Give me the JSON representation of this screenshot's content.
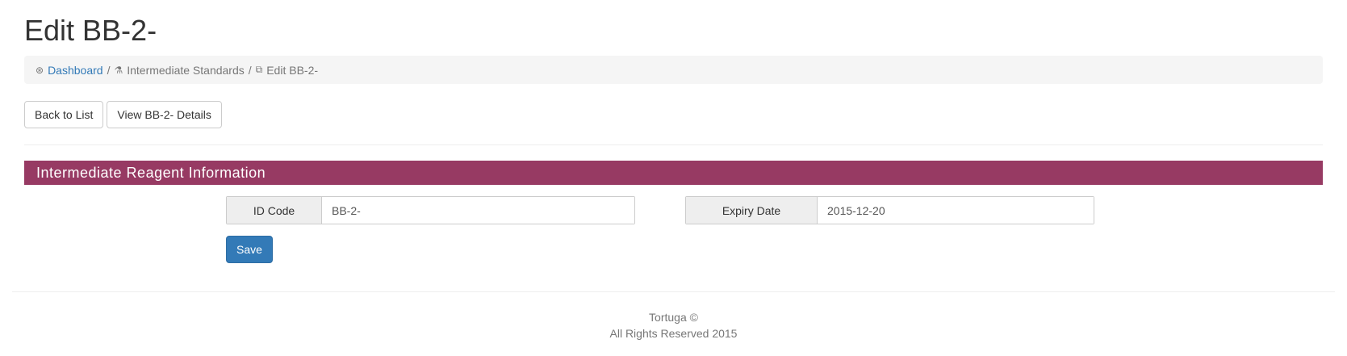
{
  "page": {
    "title": "Edit BB-2-"
  },
  "breadcrumb": {
    "items": [
      {
        "icon": "dashboard-icon",
        "glyph": "⊛",
        "label": "Dashboard"
      },
      {
        "icon": "flask-icon",
        "glyph": "⚗",
        "label": "Intermediate Standards"
      },
      {
        "icon": "copy-icon",
        "glyph": "⧉",
        "label": "Edit BB-2-"
      }
    ],
    "separator": "/"
  },
  "actions": {
    "back_label": "Back to List",
    "details_label": "View BB-2- Details"
  },
  "section": {
    "title": "Intermediate Reagent Information"
  },
  "form": {
    "id_code": {
      "label": "ID Code",
      "value": "BB-2-"
    },
    "expiry_date": {
      "label": "Expiry Date",
      "value": "2015-12-20"
    },
    "save_label": "Save"
  },
  "footer": {
    "line1": "Tortuga ©",
    "line2": "All Rights Reserved 2015"
  },
  "colors": {
    "section_header": "#973a63",
    "primary_button": "#337ab7",
    "link": "#337ab7"
  }
}
